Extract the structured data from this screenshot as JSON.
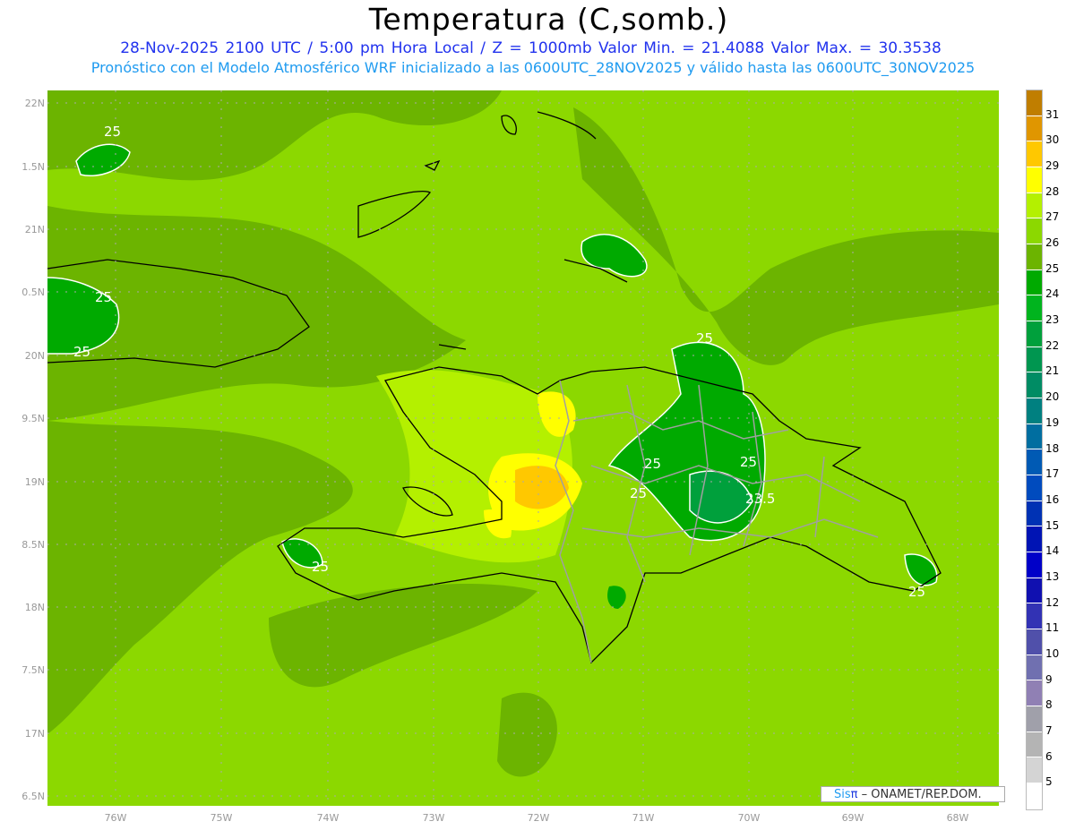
{
  "title": "Temperatura (C,somb.)",
  "subtitle1": "28-Nov-2025  2100 UTC / 5:00 pm Hora Local / Z = 1000mb    Valor Min. = 21.4088  Valor Max. = 30.3538",
  "subtitle2": "Pronóstico con el Modelo Atmosférico WRF inicializado a las 0600UTC_28NOV2025 y válido hasta las  0600UTC_30NOV2025",
  "lon_ticks": [
    "76W",
    "75W",
    "74W",
    "73W",
    "72W",
    "71W",
    "70W",
    "69W",
    "68W"
  ],
  "lat_ticks": [
    "22N",
    "1.5N",
    "21N",
    "0.5N",
    "20N",
    "9.5N",
    "19N",
    "8.5N",
    "18N",
    "7.5N",
    "17N",
    "6.5N"
  ],
  "contour_labels": [
    "25",
    "25",
    "25",
    "25",
    "25",
    "25",
    "25",
    "23.5",
    "25",
    "25"
  ],
  "credit": {
    "brand_a": "Sis",
    "brand_b": "π",
    "text": "–  ONAMET/REP.DOM."
  },
  "colorbar": {
    "labels": [
      "31",
      "30",
      "29",
      "28",
      "27",
      "26",
      "25",
      "24",
      "23",
      "22",
      "21",
      "20",
      "19",
      "18",
      "17",
      "16",
      "15",
      "14",
      "13",
      "12",
      "11",
      "10",
      "9",
      "8",
      "7",
      "6",
      "5"
    ],
    "colors": [
      "#c07e00",
      "#e09600",
      "#ffc800",
      "#ffff00",
      "#b4f000",
      "#8cd800",
      "#6cb400",
      "#00aa00",
      "#00b41e",
      "#00a03c",
      "#009650",
      "#008c64",
      "#008080",
      "#006ea0",
      "#005ab4",
      "#004bbe",
      "#0032b4",
      "#0014b4",
      "#0000c8",
      "#1010b0",
      "#3232b4",
      "#5050aa",
      "#7070b0",
      "#9080b4",
      "#a0a0aa",
      "#b4b4b4",
      "#d4d4d4",
      "#ffffff"
    ]
  }
}
